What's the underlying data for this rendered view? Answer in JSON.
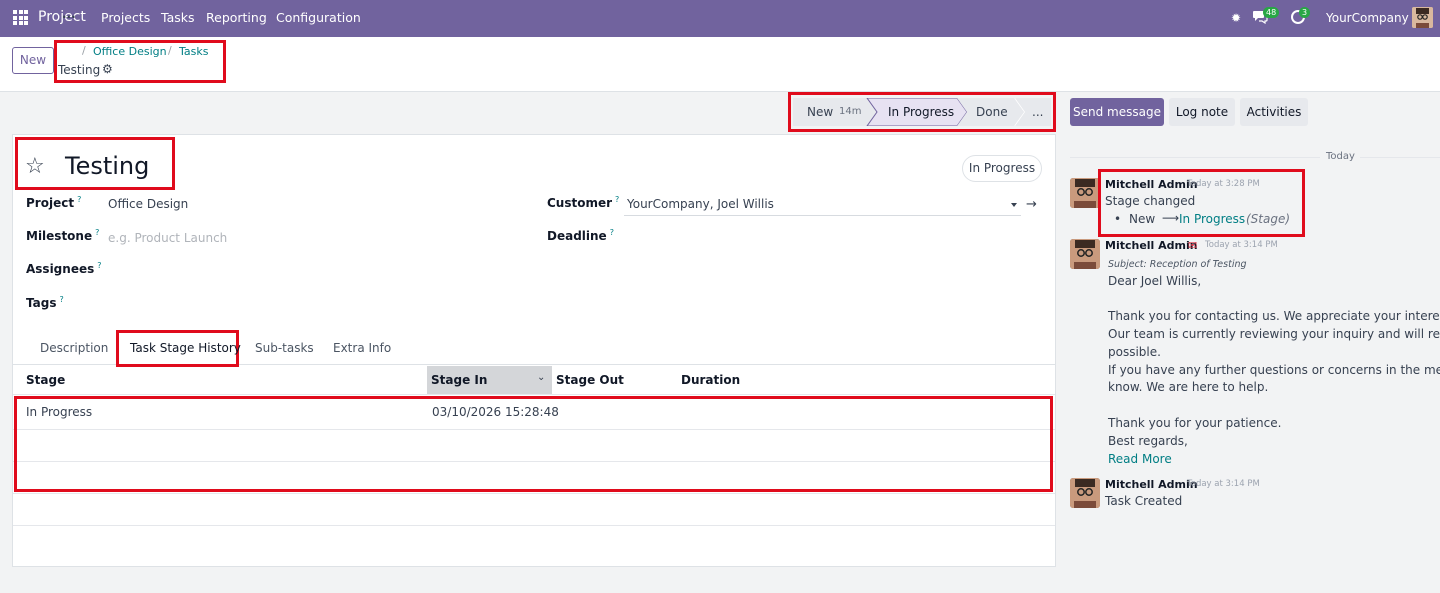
{
  "topbar": {
    "app_title": "Project",
    "menu": [
      "Projects",
      "Tasks",
      "Reporting",
      "Configuration"
    ],
    "messages_count": "48",
    "activities_count": "3",
    "company": "YourCompany"
  },
  "control": {
    "new_label": "New",
    "breadcrumb_dots": "...",
    "breadcrumb": [
      "Office Design",
      "Tasks"
    ],
    "current": "Testing"
  },
  "statusbar": {
    "stages": [
      {
        "label": "New",
        "duration": "14m"
      },
      {
        "label": "In Progress",
        "active": true
      },
      {
        "label": "Done"
      },
      {
        "label": "..."
      }
    ]
  },
  "form": {
    "title": "Testing",
    "state_pill": "In Progress",
    "fields": {
      "project_label": "Project",
      "project_value": "Office Design",
      "milestone_label": "Milestone",
      "milestone_placeholder": "e.g. Product Launch",
      "assignees_label": "Assignees",
      "tags_label": "Tags",
      "customer_label": "Customer",
      "customer_value": "YourCompany, Joel Willis",
      "deadline_label": "Deadline",
      "help": "?"
    },
    "tabs": [
      "Description",
      "Task Stage History",
      "Sub-tasks",
      "Extra Info"
    ],
    "table": {
      "headers": [
        "Stage",
        "Stage In",
        "Stage Out",
        "Duration"
      ],
      "rows": [
        {
          "stage": "In Progress",
          "stage_in": "03/10/2026 15:28:48",
          "stage_out": "",
          "duration": ""
        }
      ]
    }
  },
  "chatter": {
    "buttons": [
      "Send message",
      "Log note",
      "Activities"
    ],
    "day": "Today",
    "messages": [
      {
        "author": "Mitchell Admin",
        "time": "Today at 3:28 PM",
        "body": "Stage changed",
        "change_from": "New",
        "change_arrow": "⟶",
        "change_to": "In Progress",
        "change_field": "(Stage)"
      },
      {
        "author": "Mitchell Admin",
        "time": "Today at 3:14 PM",
        "subject": "Subject: Reception of Testing",
        "lines": [
          "Dear Joel Willis,",
          "Thank you for contacting us. We appreciate your interest in our",
          "Our team is currently reviewing your inquiry and will respond to",
          "possible.",
          "If you have any further questions or concerns in the meantime,",
          "know. We are here to help.",
          "Thank you for your patience.",
          "Best regards,"
        ],
        "read_more": "Read More"
      },
      {
        "author": "Mitchell Admin",
        "time": "Today at 3:14 PM",
        "body": "Task Created"
      }
    ]
  },
  "colors": {
    "brand": "#71639e",
    "link": "#017e84",
    "highlight": "#e00b1c"
  }
}
